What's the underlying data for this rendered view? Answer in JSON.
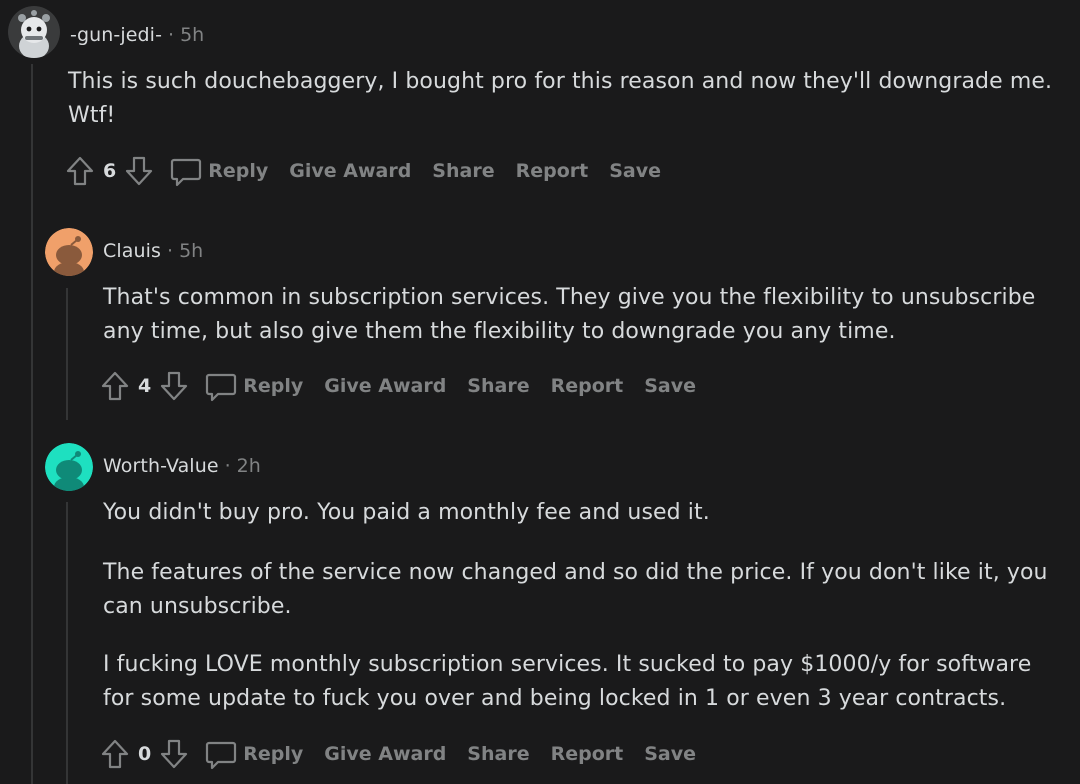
{
  "comments": [
    {
      "author": "-gun-jedi-",
      "separator": "·",
      "time": "5h",
      "paragraphs": [
        "This is such douchebaggery, I bought pro for this reason and now they'll downgrade me. Wtf!"
      ],
      "score": "6",
      "actions": {
        "reply": "Reply",
        "award": "Give Award",
        "share": "Share",
        "report": "Report",
        "save": "Save"
      }
    },
    {
      "author": "Clauis",
      "separator": "·",
      "time": "5h",
      "paragraphs": [
        "That's common in subscription services. They give you the flexibility to unsubscribe any time, but also give them the flexibility to downgrade you any time."
      ],
      "score": "4",
      "actions": {
        "reply": "Reply",
        "award": "Give Award",
        "share": "Share",
        "report": "Report",
        "save": "Save"
      }
    },
    {
      "author": "Worth-Value",
      "separator": "·",
      "time": "2h",
      "paragraphs": [
        "You didn't buy pro. You paid a monthly fee and used it.",
        "The features of the service now changed and so did the price. If you don't like it, you can unsubscribe.",
        "I fucking LOVE monthly subscription services. It sucked to pay $1000/y for software for some update to fuck you over and being locked in 1 or even 3 year contracts."
      ],
      "score": "0",
      "actions": {
        "reply": "Reply",
        "award": "Give Award",
        "share": "Share",
        "report": "Report",
        "save": "Save"
      }
    }
  ],
  "colors": {
    "background": "#1a1a1b",
    "text": "#d7dadc",
    "muted": "#818384",
    "thread_line": "#343536",
    "avatar_orange": "#f0a06a",
    "avatar_teal": "#1ee0c0"
  },
  "icons": [
    "snoo-avatar-icon",
    "upvote-icon",
    "downvote-icon",
    "reply-bubble-icon"
  ]
}
